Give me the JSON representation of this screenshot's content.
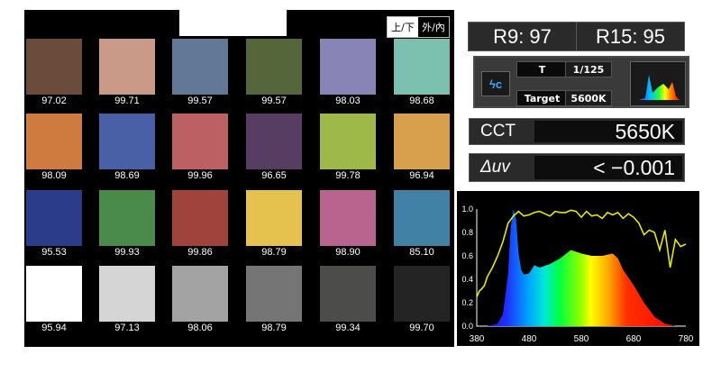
{
  "view_toggle": {
    "option_a": "上/下",
    "option_b": "外/內"
  },
  "swatches": [
    {
      "color": "#6b4c3c",
      "value": "97.02"
    },
    {
      "color": "#c99a87",
      "value": "99.71"
    },
    {
      "color": "#627896",
      "value": "99.57"
    },
    {
      "color": "#54663a",
      "value": "99.57"
    },
    {
      "color": "#8884b6",
      "value": "98.03"
    },
    {
      "color": "#7cc0b0",
      "value": "98.68"
    },
    {
      "color": "#cf7a3e",
      "value": "98.09"
    },
    {
      "color": "#495fa6",
      "value": "98.69"
    },
    {
      "color": "#bd6064",
      "value": "99.96"
    },
    {
      "color": "#573d62",
      "value": "96.65"
    },
    {
      "color": "#9fb84a",
      "value": "99.78"
    },
    {
      "color": "#d8a04c",
      "value": "96.94"
    },
    {
      "color": "#2b3d8a",
      "value": "95.53"
    },
    {
      "color": "#4a8a4a",
      "value": "99.93"
    },
    {
      "color": "#a0433d",
      "value": "99.86"
    },
    {
      "color": "#e5c24e",
      "value": "98.79"
    },
    {
      "color": "#b8648e",
      "value": "98.90"
    },
    {
      "color": "#4281a6",
      "value": "85.10"
    },
    {
      "color": "#ffffff",
      "value": "95.94"
    },
    {
      "color": "#d5d5d5",
      "value": "97.13"
    },
    {
      "color": "#a3a3a3",
      "value": "98.06"
    },
    {
      "color": "#757575",
      "value": "98.79"
    },
    {
      "color": "#4c4c4a",
      "value": "99.34"
    },
    {
      "color": "#242424",
      "value": "99.70"
    }
  ],
  "r_values": {
    "r9": "R9: 97",
    "r15": "R15: 95"
  },
  "settings": {
    "ae_icon_label": "ϟc",
    "shutter_label": "T",
    "shutter_value": "1/125",
    "target_label": "Target",
    "target_value": "5600K"
  },
  "cct": {
    "label": "CCT",
    "value": "5650K"
  },
  "duv": {
    "label": "Δuv",
    "value": "< −0.001"
  },
  "chart_data": {
    "type": "area",
    "x_ticks": [
      "380",
      "480",
      "580",
      "680",
      "780"
    ],
    "y_ticks": [
      "1.0",
      "0.8",
      "0.6",
      "0.4",
      "0.2",
      "0.0"
    ],
    "xlim": [
      380,
      780
    ],
    "ylim": [
      0,
      1.0
    ],
    "series": [
      {
        "type": "area",
        "fill": "visible-spectrum",
        "x": [
          380,
          400,
          420,
          430,
          440,
          445,
          450,
          455,
          460,
          465,
          470,
          480,
          490,
          500,
          520,
          540,
          560,
          580,
          600,
          620,
          640,
          650,
          660,
          680,
          700,
          720,
          740,
          760,
          780
        ],
        "y": [
          0.0,
          0.0,
          0.02,
          0.1,
          0.45,
          0.85,
          1.0,
          0.92,
          0.62,
          0.48,
          0.44,
          0.45,
          0.52,
          0.5,
          0.53,
          0.58,
          0.65,
          0.62,
          0.6,
          0.6,
          0.62,
          0.58,
          0.48,
          0.35,
          0.2,
          0.08,
          0.02,
          0.0,
          0.0
        ]
      },
      {
        "type": "line",
        "color": "#e8e800",
        "x": [
          380,
          385,
          390,
          395,
          400,
          410,
          420,
          430,
          440,
          450,
          460,
          470,
          480,
          490,
          500,
          510,
          520,
          530,
          540,
          550,
          560,
          570,
          580,
          590,
          600,
          610,
          620,
          630,
          640,
          650,
          660,
          670,
          680,
          690,
          700,
          710,
          720,
          730,
          740,
          750,
          760,
          770,
          780
        ],
        "y": [
          0.25,
          0.3,
          0.32,
          0.35,
          0.42,
          0.5,
          0.6,
          0.72,
          0.88,
          0.94,
          0.98,
          0.94,
          0.95,
          0.97,
          0.98,
          0.96,
          0.94,
          0.98,
          0.97,
          0.97,
          0.99,
          0.98,
          0.93,
          0.98,
          0.94,
          0.95,
          0.92,
          0.97,
          0.95,
          0.97,
          0.92,
          0.96,
          0.93,
          0.88,
          0.78,
          0.82,
          0.8,
          0.65,
          0.82,
          0.5,
          0.74,
          0.68,
          0.7
        ]
      }
    ]
  }
}
